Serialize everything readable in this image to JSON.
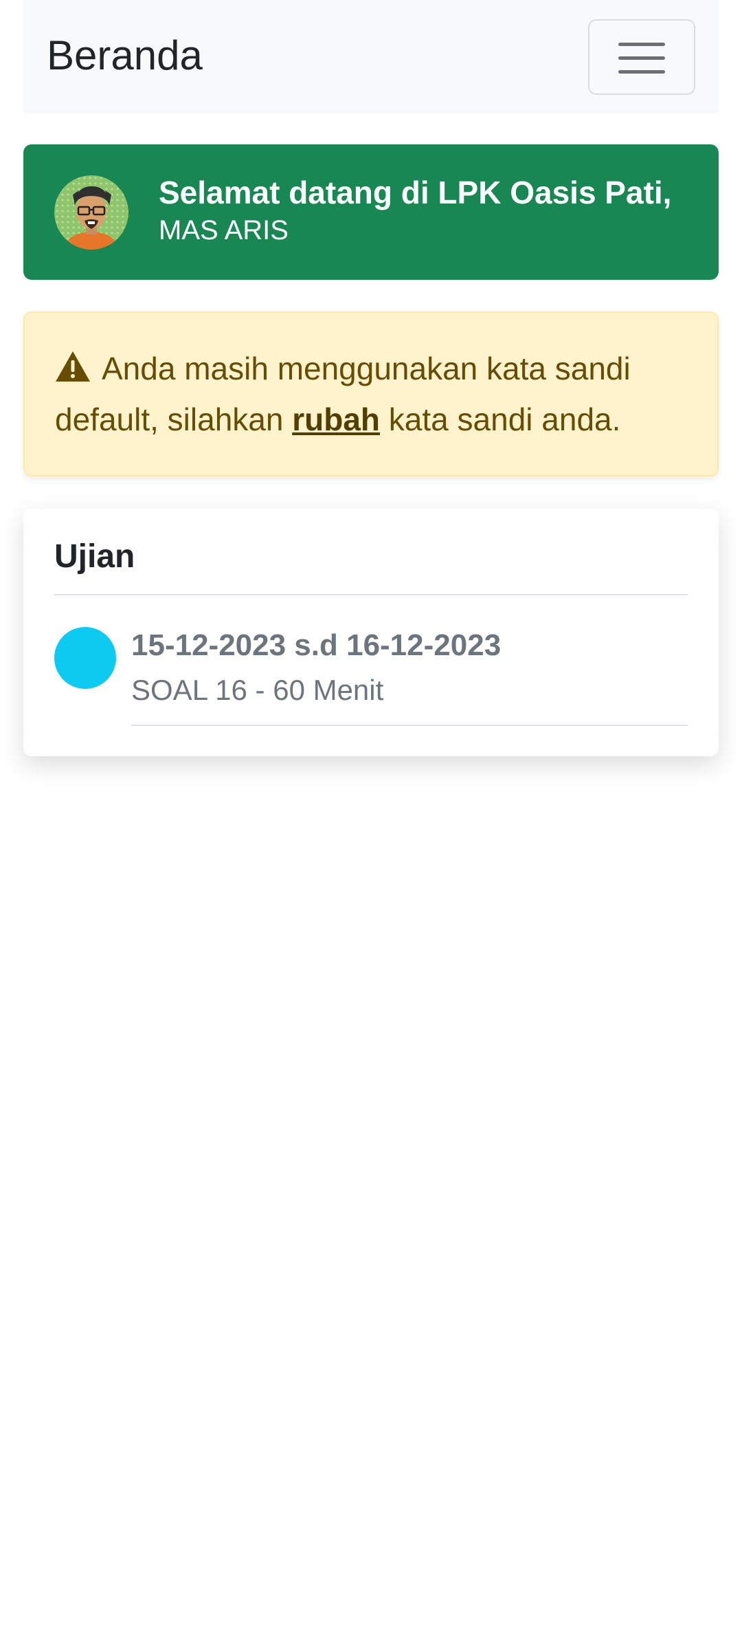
{
  "navbar": {
    "brand": "Beranda",
    "toggler_icon": "hamburger-menu-icon"
  },
  "welcome": {
    "title": "Selamat datang di LPK Oasis Pati,",
    "name": "MAS ARIS",
    "avatar_icon": "user-avatar"
  },
  "alert": {
    "icon": "warning-triangle-icon",
    "text_before": "Anda masih menggunakan kata sandi default, silahkan",
    "link": "rubah",
    "text_after": "kata sandi anda."
  },
  "exams": {
    "title": "Ujian",
    "items": [
      {
        "date": "15-12-2023 s.d 16-12-2023",
        "desc": "SOAL 16 - 60 Menit",
        "status_color": "#0dcaf0"
      }
    ]
  },
  "colors": {
    "success": "#198754",
    "warning_bg": "#fff3cd",
    "warning_text": "#664d03",
    "info": "#0dcaf0",
    "muted": "#6c757d"
  }
}
